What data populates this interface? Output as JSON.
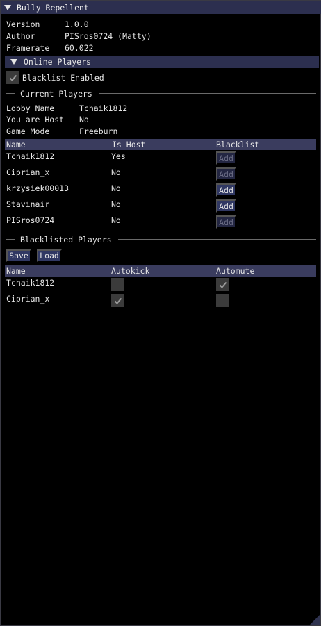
{
  "window": {
    "title": "Bully Repellent"
  },
  "info": {
    "version_label": "Version",
    "version_value": "1.0.0",
    "author_label": "Author",
    "author_value": "PISros0724 (Matty)",
    "framerate_label": "Framerate",
    "framerate_value": "60.022"
  },
  "online_players": {
    "header": "Online Players",
    "blacklist_enabled_label": "Blacklist Enabled",
    "blacklist_enabled": true
  },
  "current_players": {
    "section_title": "Current Players",
    "lobby_name_label": "Lobby Name",
    "lobby_name_value": "Tchaik1812",
    "host_label": "You are Host",
    "host_value": "No",
    "game_mode_label": "Game Mode",
    "game_mode_value": "Freeburn",
    "columns": {
      "name": "Name",
      "is_host": "Is Host",
      "blacklist": "Blacklist"
    },
    "rows": [
      {
        "name": "Tchaik1812",
        "is_host": "Yes",
        "action": "Add",
        "enabled": false
      },
      {
        "name": "Ciprian_x",
        "is_host": "No",
        "action": "Add",
        "enabled": false
      },
      {
        "name": "krzysiek00013",
        "is_host": "No",
        "action": "Add",
        "enabled": true
      },
      {
        "name": "Stavinair",
        "is_host": "No",
        "action": "Add",
        "enabled": true
      },
      {
        "name": "PISros0724",
        "is_host": "No",
        "action": "Add",
        "enabled": false
      }
    ]
  },
  "blacklisted_players": {
    "section_title": "Blacklisted Players",
    "save_label": "Save",
    "load_label": "Load",
    "columns": {
      "name": "Name",
      "autokick": "Autokick",
      "automute": "Automute"
    },
    "rows": [
      {
        "name": "Tchaik1812",
        "autokick": false,
        "automute": true
      },
      {
        "name": "Ciprian_x",
        "autokick": true,
        "automute": false
      }
    ]
  },
  "colors": {
    "title_bg": "#2c2f4f",
    "table_header_bg": "#3a3c5e",
    "button_bg": "#303863",
    "checkbox_bg": "#3b3b3b",
    "text": "#e6e6e6"
  }
}
